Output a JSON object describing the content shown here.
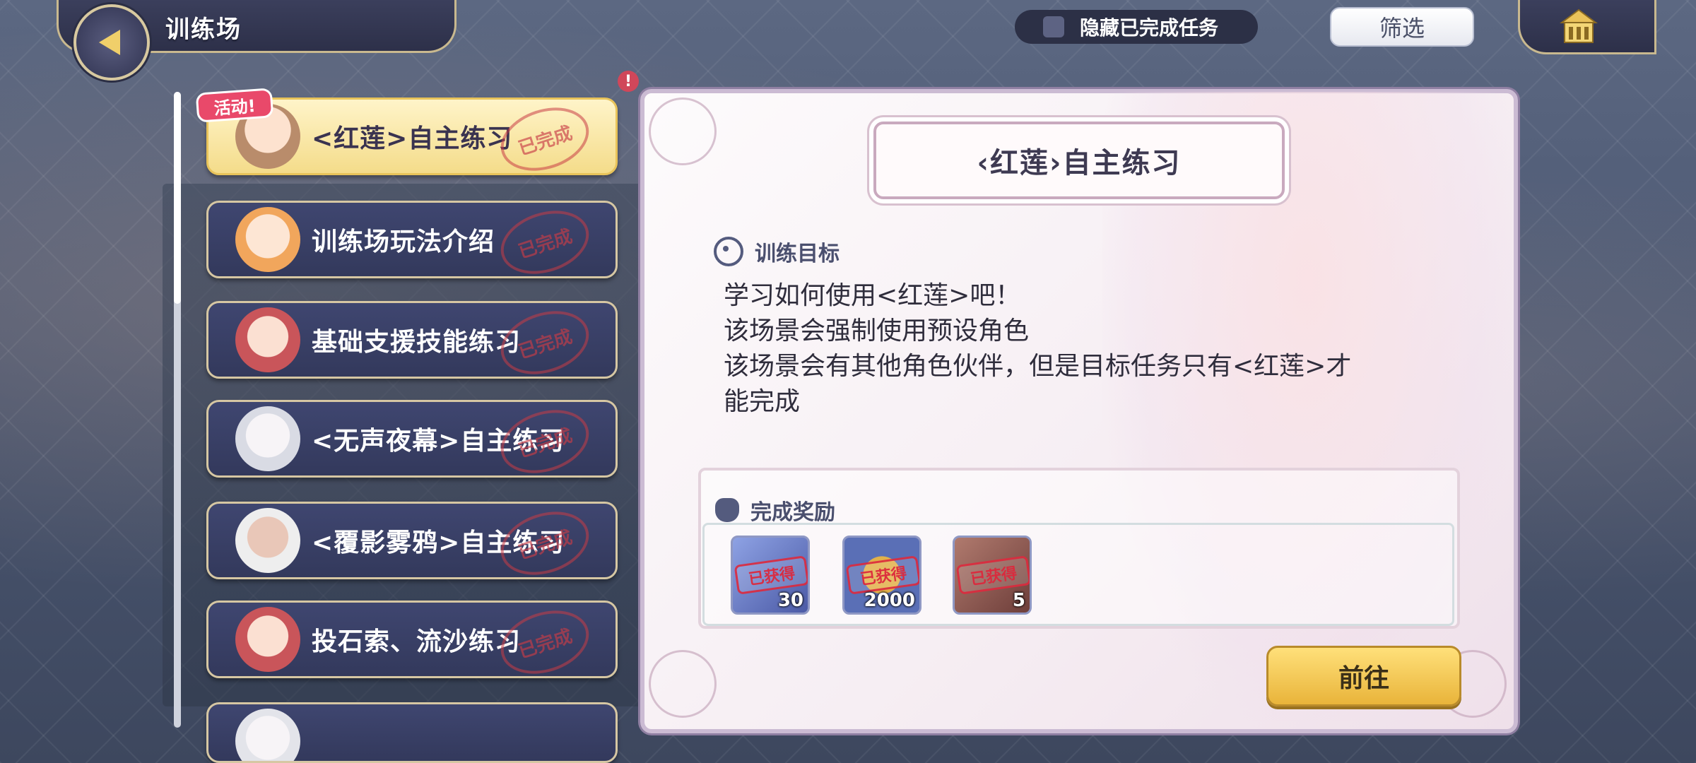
{
  "header": {
    "title": "训练场",
    "hide_completed_label": "隐藏已完成任务",
    "filter_label": "筛选"
  },
  "list": {
    "event_badge": "活动!",
    "completed_stamp": "已完成",
    "items": [
      {
        "label": "<红莲>自主练习"
      },
      {
        "label": "训练场玩法介绍"
      },
      {
        "label": "基础支援技能练习"
      },
      {
        "label": "<无声夜幕>自主练习"
      },
      {
        "label": "<覆影雾鸦>自主练习"
      },
      {
        "label": "投石索、流沙练习"
      }
    ]
  },
  "detail": {
    "title": "‹红莲›自主练习",
    "objective_heading": "训练目标",
    "description_lines": [
      "学习如何使用<红莲>吧！",
      "该场景会强制使用预设角色",
      "该场景会有其他角色伙伴，但是目标任务只有<红莲>才",
      "能完成"
    ],
    "reward_heading": "完成奖励",
    "reward_obtained_stamp": "已获得",
    "rewards": [
      {
        "qty": "30",
        "color": "#6c7fc8"
      },
      {
        "qty": "2000",
        "color": "#5a6fb6"
      },
      {
        "qty": "5",
        "color": "#8a5a55"
      }
    ],
    "go_button": "前往"
  },
  "colors": {
    "active_task": "#f4dc8a",
    "task_bg": "#3f4670",
    "panel_bg": "#fdfbfc",
    "go_button": "#e9b43a"
  }
}
